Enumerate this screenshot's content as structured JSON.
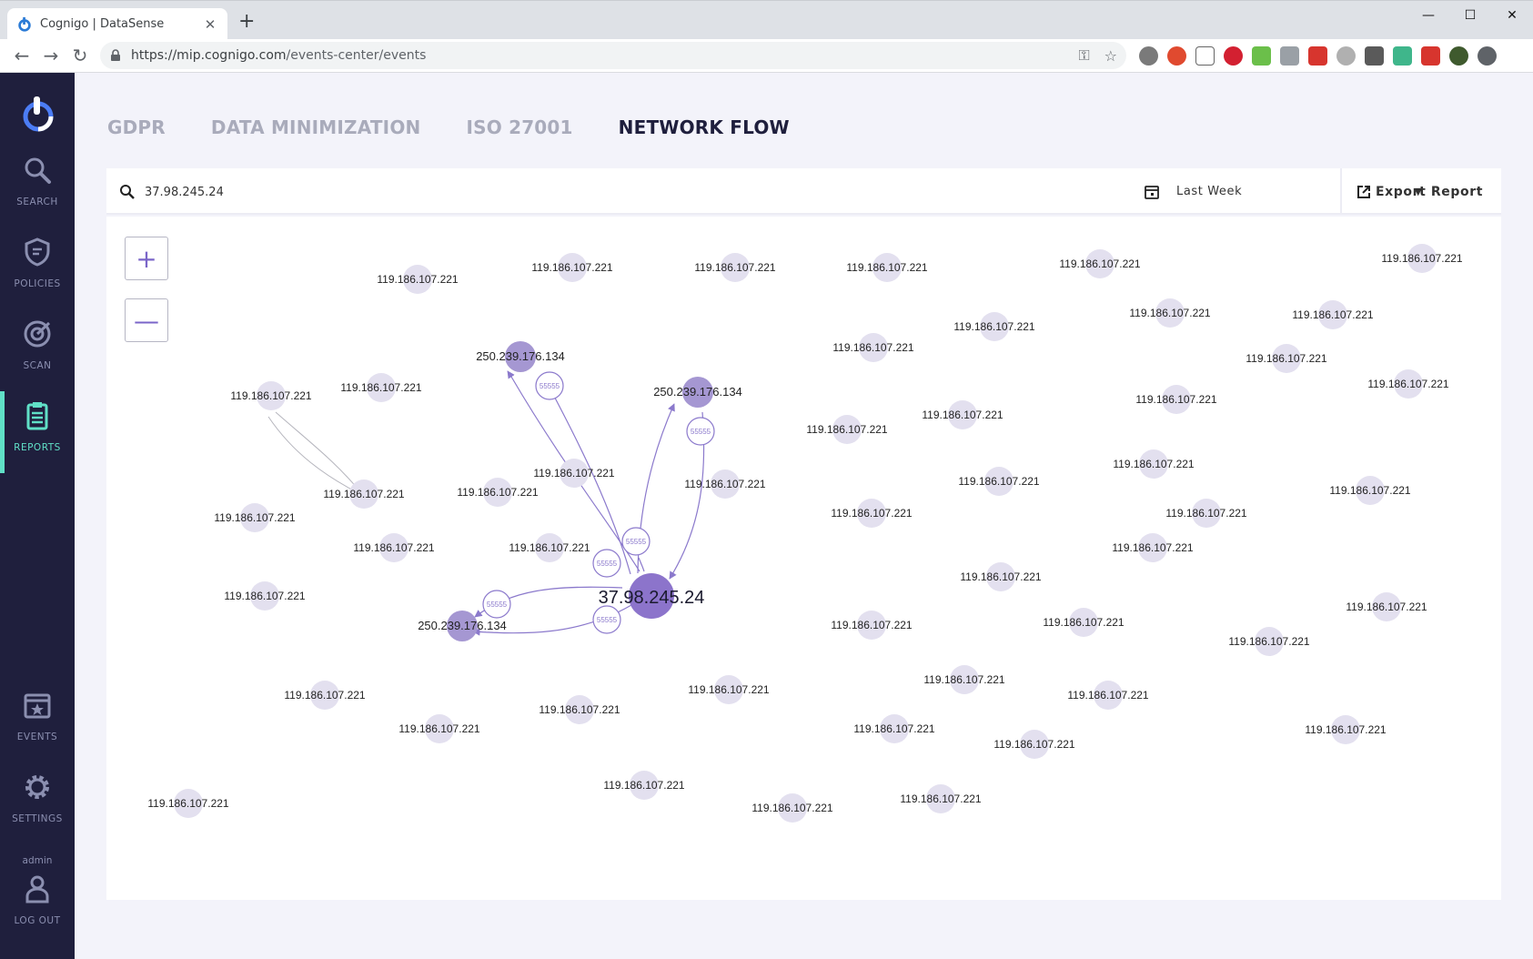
{
  "browser": {
    "tab_title": "Cognigo | DataSense",
    "tab_close": "✕",
    "new_tab": "+",
    "url_host": "https://mip.cognigo.com",
    "url_path": "/events-center/events",
    "win_min": "—",
    "win_max": "☐",
    "win_close": "✕"
  },
  "sidebar": {
    "items": [
      {
        "label": "SEARCH",
        "icon": "search-icon"
      },
      {
        "label": "POLICIES",
        "icon": "shield-icon"
      },
      {
        "label": "SCAN",
        "icon": "radar-icon"
      },
      {
        "label": "REPORTS",
        "icon": "clipboard-icon",
        "active": true
      },
      {
        "label": "EVENTS",
        "icon": "calendar-star-icon"
      },
      {
        "label": "SETTINGS",
        "icon": "gear-icon"
      },
      {
        "label": "LOG OUT",
        "icon": "user-icon"
      }
    ],
    "admin_label": "admin"
  },
  "tabs": [
    {
      "label": "GDPR",
      "active": false
    },
    {
      "label": "DATA MINIMIZATION",
      "active": false
    },
    {
      "label": "ISO 27001",
      "active": false
    },
    {
      "label": "NETWORK FLOW",
      "active": true
    }
  ],
  "filter": {
    "search_value": "37.98.245.24",
    "date_range": "Last Week",
    "export_label": "Export Report"
  },
  "zoom": {
    "in": "+",
    "out": "—"
  },
  "graph": {
    "colors": {
      "background_node": "#e3e0ef",
      "peer_node": "#a597d2",
      "center_node": "#8c74cb",
      "edge": "#8b79cc",
      "faint_edge": "#b5b5bd"
    },
    "center_label": "37.98.245.24",
    "peer_label": "250.239.176.134",
    "bg_label": "119.186.107.221",
    "port_label": "55555"
  }
}
